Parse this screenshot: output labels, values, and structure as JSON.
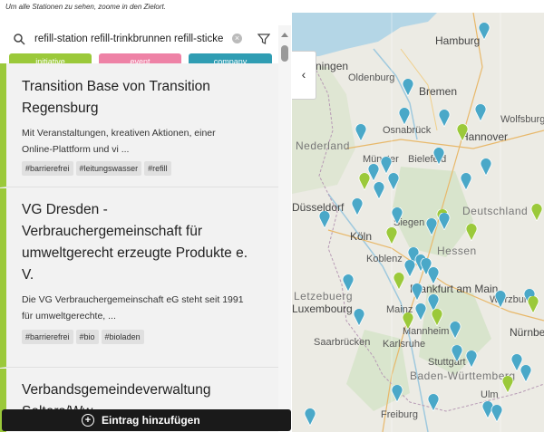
{
  "hint": "Um alle Stationen zu sehen, zoome in den Zielort.",
  "search": {
    "value": "refill-station refill-trinkbrunnen refill-sticke"
  },
  "categories": [
    {
      "label": "initiative",
      "color": "#9bc93a"
    },
    {
      "label": "event",
      "color": "#ee82a6"
    },
    {
      "label": "company",
      "color": "#2f9db3"
    }
  ],
  "entries": [
    {
      "title_lines": [
        "Transition Base von Transition",
        "Regensburg"
      ],
      "desc_lines": [
        "Mit Veranstaltungen, kreativen Aktionen, einer",
        "Online-Plattform und vi ..."
      ],
      "tags": [
        "#barrierefrei",
        "#leitungswasser",
        "#refill"
      ]
    },
    {
      "title_lines": [
        "VG Dresden -",
        "Verbrauchergemeinschaft für",
        "umweltgerecht erzeugte Produkte e.",
        "V."
      ],
      "desc_lines": [
        "Die VG Verbrauchergemeinschaft eG steht seit 1991",
        "für umweltgerechte, ..."
      ],
      "tags": [
        "#barrierefrei",
        "#bio",
        "#bioladen"
      ]
    },
    {
      "title_lines": [
        "Verbandsgemeindeverwaltung",
        "Selters/Ww"
      ],
      "desc_lines": [],
      "tags": []
    }
  ],
  "add_button": {
    "label": "Eintrag hinzufügen"
  },
  "map": {
    "cities": [
      "Hamburg",
      "Groningen",
      "Oldenburg",
      "Bremen",
      "Osnabrück",
      "Hannover",
      "Wolfsburg",
      "Bielefeld",
      "Münster",
      "Nederland",
      "Düsseldorf",
      "Siegen",
      "Köln",
      "Deutschland",
      "Koblenz",
      "Hessen",
      "Frankfurt am Main",
      "Letzebuerg",
      "Mainz",
      "Luxembourg",
      "Mannheim",
      "Würzburg",
      "Saarbrücken",
      "Karlsruhe",
      "Nürnberg",
      "Stuttgart",
      "Baden-Württemberg",
      "Ulm",
      "Freiburg"
    ],
    "pin_colors": {
      "company": "#4aa8c8",
      "initiative": "#9bc93a"
    }
  }
}
